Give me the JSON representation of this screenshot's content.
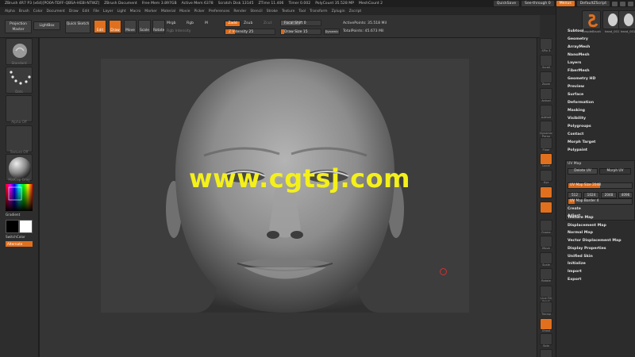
{
  "titlebar": {
    "segments": [
      "ZBrush 4R7 P3 (x64)[PO0A-TDFF-QBSA-HEBI-NTWZ]",
      "ZBrush Document",
      "Free Mem 3.897GB",
      "Active Mem 6378",
      "Scratch Disk 13145",
      "ZTime 11.406",
      "Timer 0.002",
      "PolyCount 35.528 MP",
      "MeshCount 2"
    ],
    "quicksave": "QuickSave",
    "seethrough": "See-through  0",
    "menus_label": "Menus",
    "script_label": "DefaultZScript"
  },
  "menubar": {
    "items": [
      "Alpha",
      "Brush",
      "Color",
      "Document",
      "Draw",
      "Edit",
      "File",
      "Layer",
      "Light",
      "Macro",
      "Marker",
      "Material",
      "Movie",
      "Picker",
      "Preferences",
      "Render",
      "Stencil",
      "Stroke",
      "Texture",
      "Tool",
      "Transform",
      "Zplugin",
      "Zscript"
    ]
  },
  "shelf": {
    "projection_master": "Projection Master",
    "lightbox": "LightBox",
    "quick_sketch": "Quick Sketch",
    "edit": "Edit",
    "draw": "Draw",
    "move": "Move",
    "scale": "Scale",
    "rotate": "Rotate",
    "mrgb": "Mrgb",
    "rgb": "Rgb",
    "m": "M",
    "rgb_intensity": "Rgb Intensity",
    "zadd": "Zadd",
    "zsub": "Zsub",
    "zcut": "Zcut",
    "z_intensity": "Z Intensity 25",
    "focal_shift": "Focal Shift 0",
    "draw_size": "Draw Size 15",
    "dynamic": "Dynamic",
    "active_points": "ActivePoints: 35.518 Mil",
    "total_points": "TotalPoints: 45.673 Mil"
  },
  "lefttray": {
    "captions": [
      "Standard",
      "Dots",
      "Alpha Off",
      "Texture Off",
      "MatCap Gray"
    ],
    "gradient": "Gradient",
    "switchcolor": "SwitchColor",
    "alternate": "Alternate"
  },
  "rightcol": {
    "captions": [
      "SPix 3",
      "Scroll",
      "Zoom",
      "Actual",
      "AAHalf",
      "Dynamic Persp",
      "Floor",
      "Local",
      "Xyz",
      "",
      "",
      "Frame",
      "Move",
      "Scale",
      "Rotate",
      "Line Fill PolyF",
      "Transp",
      "Ghost",
      "Solo",
      "Xpose"
    ]
  },
  "palette": {
    "tools": [
      "SimpleBrush",
      "head_001",
      "head_001"
    ],
    "items_top": [
      "Subtool",
      "Geometry",
      "ArrayMesh",
      "NanoMesh",
      "Layers",
      "FiberMesh",
      "Geometry HD",
      "Preview",
      "Surface",
      "Deformation",
      "Masking",
      "Visibility",
      "Polygroups",
      "Contact",
      "Morph Target",
      "Polypaint"
    ],
    "uv": {
      "header": "UV Map",
      "delete_uv": "Delete UV",
      "morph_uv": "Morph UV",
      "uv_map_size": "UV Map Size 2048",
      "sizes": [
        "512",
        "1024",
        "2048",
        "4096"
      ],
      "uv_map_border": "UV Map Border 4",
      "create": "Create",
      "adjust": "Adjust"
    },
    "items_bottom": [
      "Texture Map",
      "Displacement Map",
      "Normal Map",
      "Vector Displacement Map",
      "Display Properties",
      "Unified Skin",
      "Initialize",
      "Import",
      "Export"
    ]
  },
  "watermark": "www.cgtsj.com"
}
